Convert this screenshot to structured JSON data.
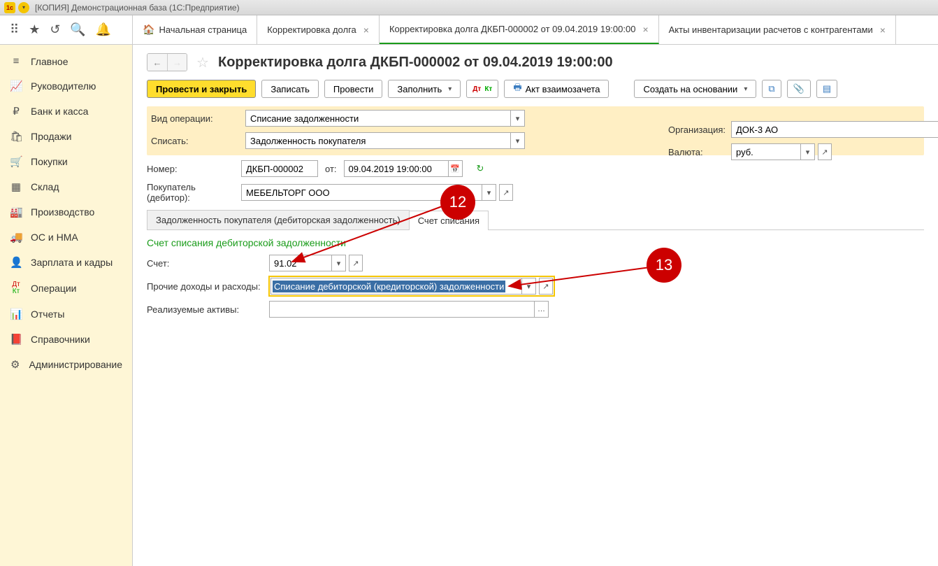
{
  "window_title": "[КОПИЯ] Демонстрационная база  (1С:Предприятие)",
  "tabs": {
    "home": "Начальная страница",
    "t1": "Корректировка долга",
    "t2": "Корректировка долга ДКБП-000002 от 09.04.2019 19:00:00",
    "t3": "Акты инвентаризации расчетов с контрагентами"
  },
  "sidebar": [
    {
      "icon": "≡",
      "label": "Главное"
    },
    {
      "icon": "📈",
      "label": "Руководителю"
    },
    {
      "icon": "₽",
      "label": "Банк и касса"
    },
    {
      "icon": "🛍",
      "label": "Продажи"
    },
    {
      "icon": "🛒",
      "label": "Покупки"
    },
    {
      "icon": "▦",
      "label": "Склад"
    },
    {
      "icon": "🏭",
      "label": "Производство"
    },
    {
      "icon": "🚚",
      "label": "ОС и НМА"
    },
    {
      "icon": "👤",
      "label": "Зарплата и кадры"
    },
    {
      "icon": "Дт",
      "label": "Операции"
    },
    {
      "icon": "📊",
      "label": "Отчеты"
    },
    {
      "icon": "📕",
      "label": "Справочники"
    },
    {
      "icon": "⚙",
      "label": "Администрирование"
    }
  ],
  "page_title": "Корректировка долга ДКБП-000002 от 09.04.2019 19:00:00",
  "buttons": {
    "submit_close": "Провести и закрыть",
    "save": "Записать",
    "submit": "Провести",
    "fill": "Заполнить",
    "act": "Акт взаимозачета",
    "create_based": "Создать на основании"
  },
  "fields": {
    "op_type_label": "Вид операции:",
    "op_type_value": "Списание задолженности",
    "write_off_label": "Списать:",
    "write_off_value": "Задолженность покупателя",
    "number_label": "Номер:",
    "number_value": "ДКБП-000002",
    "from_label": "от:",
    "date_value": "09.04.2019 19:00:00",
    "buyer_label": "Покупатель (дебитор):",
    "buyer_value": "МЕБЕЛЬТОРГ ООО",
    "org_label": "Организация:",
    "org_value": "ДОК-3 АО",
    "currency_label": "Валюта:",
    "currency_value": "руб."
  },
  "sub_tabs": {
    "t1": "Задолженность покупателя (дебиторская задолженность)",
    "t2": "Счет списания"
  },
  "section": {
    "title": "Счет списания дебиторской задолженности",
    "account_label": "Счет:",
    "account_value": "91.02",
    "other_label": "Прочие доходы и расходы:",
    "other_value": "Списание дебиторской (кредиторской) задолженности",
    "assets_label": "Реализуемые активы:",
    "assets_value": ""
  },
  "callouts": {
    "c12": "12",
    "c13": "13"
  }
}
